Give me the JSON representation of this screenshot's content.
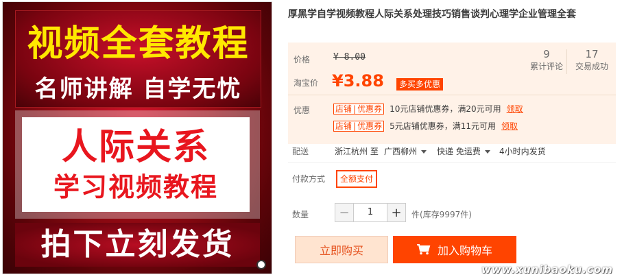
{
  "poster": {
    "headline": "视频全套教程",
    "subline": "名师讲解 自学无忧",
    "main_line1": "人际关系",
    "main_line2": "学习视频教程",
    "footer": "拍下立刻发货"
  },
  "product": {
    "title": "厚黑学自学视频教程人际关系处理技巧销售谈判心理学企业管理全套"
  },
  "price": {
    "price_label": "价格",
    "original": "¥ 8.00",
    "taobao_label": "淘宝价",
    "current": "¥3.88",
    "promo_badge": "多买多优惠"
  },
  "stats": [
    {
      "value": "9",
      "label": "累计评论"
    },
    {
      "value": "17",
      "label": "交易成功"
    }
  ],
  "coupons": {
    "label": "优惠",
    "items": [
      {
        "tag_left": "店铺",
        "tag_right": "优惠券",
        "text": "10元店铺优惠券，满20元可用",
        "link": "领取"
      },
      {
        "tag_left": "店铺",
        "tag_right": "优惠券",
        "text": "5元店铺优惠券，满11元可用",
        "link": "领取"
      }
    ]
  },
  "shipping": {
    "label": "配送",
    "from": "浙江杭州 至",
    "to": "广西柳州",
    "method": "快递 免运费",
    "time": "4小时内发货"
  },
  "payment": {
    "label": "付款方式",
    "option": "全额支付"
  },
  "quantity": {
    "label": "数量",
    "minus": "−",
    "value": "1",
    "plus": "+",
    "stock": "件(库存9997件)"
  },
  "actions": {
    "buy_now": "立即购买",
    "add_cart": "加入购物车"
  },
  "watermark": "www.xunibaoku.com",
  "colors": {
    "accent": "#ff4400",
    "panel": "#fff2e8"
  }
}
